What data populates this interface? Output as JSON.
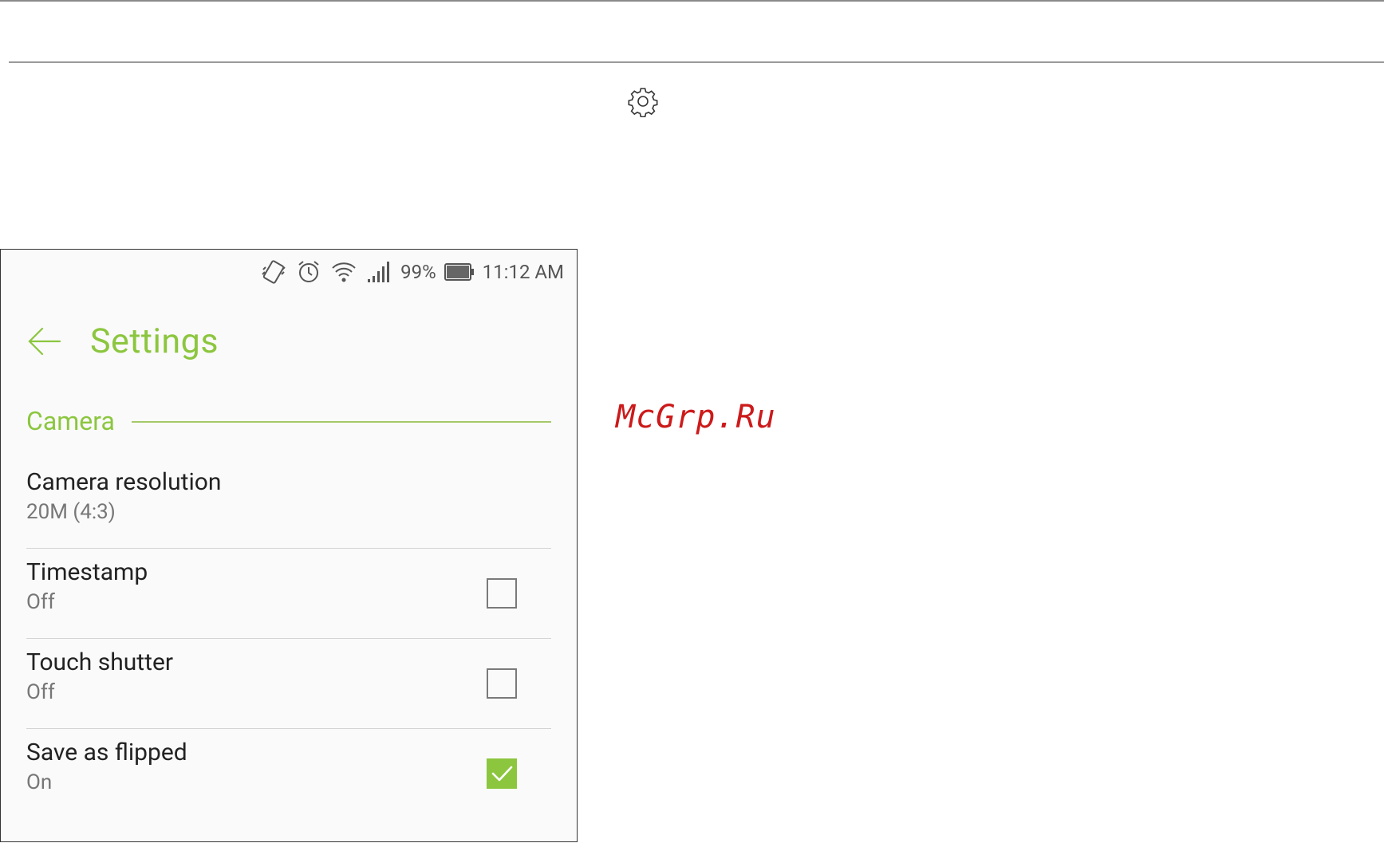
{
  "status_bar": {
    "battery_percent": "99%",
    "time": "11:12 AM",
    "icons": [
      "vibrate-icon",
      "alarm-icon",
      "wifi-icon",
      "signal-icon",
      "battery-icon"
    ]
  },
  "app_bar": {
    "title": "Settings",
    "back_icon": "arrow-left-icon"
  },
  "section": {
    "label": "Camera"
  },
  "settings": [
    {
      "name": "Camera resolution",
      "value": "20M (4:3)",
      "has_checkbox": false
    },
    {
      "name": "Timestamp",
      "value": "Off",
      "has_checkbox": true,
      "checked": false
    },
    {
      "name": "Touch shutter",
      "value": "Off",
      "has_checkbox": true,
      "checked": false
    },
    {
      "name": "Save as flipped",
      "value": "On",
      "has_checkbox": true,
      "checked": true
    }
  ],
  "watermark": "McGrp.Ru",
  "colors": {
    "accent": "#8cc63f",
    "text": "#222222",
    "subtext": "#777777"
  },
  "page_icon": "gear-icon"
}
